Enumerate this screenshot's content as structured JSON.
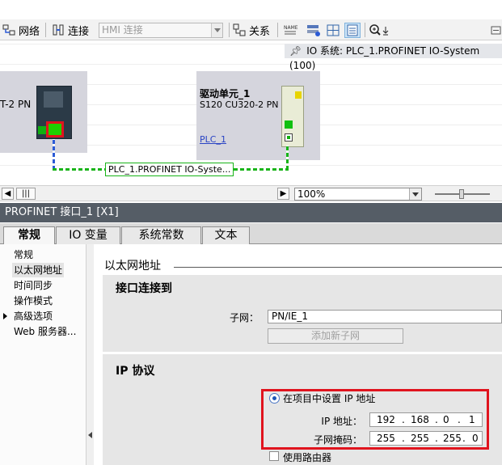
{
  "toolbar": {
    "network_label": "网络",
    "connect_label": "连接",
    "hmi_select_value": "HMI 连接",
    "relation_label": "关系"
  },
  "canvas": {
    "io_system_label": "IO 系统: PLC_1.PROFINET IO-System (100)",
    "left_device_name": "T-2 PN",
    "right_device_title": "驱动单元_1",
    "right_device_sub": "S120 CU320-2 PN",
    "right_device_plc_link": "PLC_1",
    "network_label": "PLC_1.PROFINET IO-Syste..."
  },
  "scrollrow": {
    "zoom_value": "100%"
  },
  "properties": {
    "title": "PROFINET 接口_1 [X1]",
    "tabs": [
      {
        "label": "常规"
      },
      {
        "label": "IO 变量"
      },
      {
        "label": "系统常数"
      },
      {
        "label": "文本"
      }
    ],
    "nav": [
      {
        "label": "常规"
      },
      {
        "label": "以太网地址"
      },
      {
        "label": "时间同步"
      },
      {
        "label": "操作模式"
      },
      {
        "label": "高级选项"
      },
      {
        "label": "Web 服务器..."
      }
    ],
    "section_title": "以太网地址",
    "interface_panel": {
      "title": "接口连接到",
      "subnet_label": "子网：",
      "subnet_value": "PN/IE_1",
      "add_subnet_button": "添加新子网"
    },
    "ip_panel": {
      "title": "IP 协议",
      "radio_label": "在项目中设置 IP 地址",
      "ip_label": "IP 地址：",
      "ip": [
        "192",
        "168",
        "0",
        "1"
      ],
      "mask_label": "子网掩码：",
      "mask": [
        "255",
        "255",
        "255",
        "0"
      ],
      "use_router_label": "使用路由器"
    }
  },
  "colors": {
    "highlight": "#e0141e",
    "network_green": "#18b418",
    "title_bar": "#555d66"
  }
}
